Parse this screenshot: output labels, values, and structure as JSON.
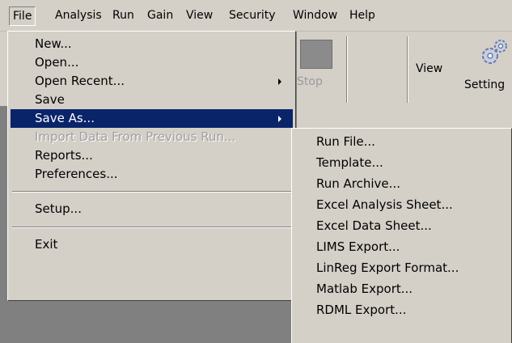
{
  "menubar": {
    "items": [
      "File",
      "Analysis",
      "Run",
      "Gain",
      "View",
      "Security",
      "Window",
      "Help"
    ]
  },
  "toolbar": {
    "stop_label": "Stop",
    "view_label": "View",
    "settings_label": "Setting"
  },
  "file_menu": {
    "items": [
      {
        "label": "New..."
      },
      {
        "label": "Open..."
      },
      {
        "label": "Open Recent...",
        "has_submenu": true
      },
      {
        "label": "Save"
      },
      {
        "label": "Save As...",
        "has_submenu": true,
        "highlighted": true
      },
      {
        "label": "Import Data From Previous Run...",
        "disabled": true
      },
      {
        "label": "Reports..."
      },
      {
        "label": "Preferences..."
      },
      {
        "label": "Setup..."
      },
      {
        "label": "Exit"
      }
    ]
  },
  "save_as_submenu": {
    "items": [
      "Run File...",
      "Template...",
      "Run Archive...",
      "Excel Analysis Sheet...",
      "Excel Data Sheet...",
      "LIMS Export...",
      "LinReg Export Format...",
      "Matlab Export...",
      "RDML Export..."
    ]
  },
  "colors": {
    "menu_bg": "#d4d0c8",
    "highlight": "#0a246a",
    "background": "#808080"
  }
}
